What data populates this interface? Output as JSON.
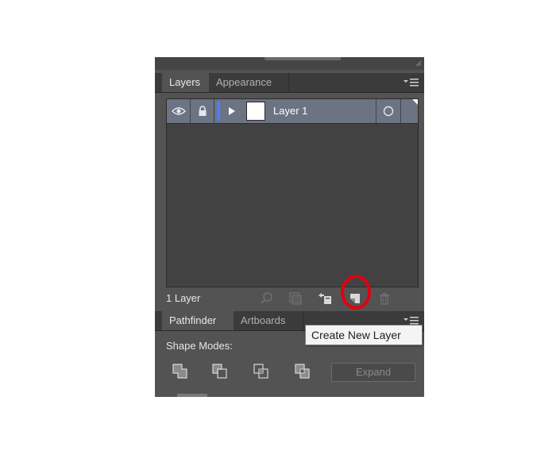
{
  "layers_panel": {
    "tabs": [
      {
        "label": "Layers",
        "active": true
      },
      {
        "label": "Appearance",
        "active": false
      }
    ],
    "layer": {
      "name": "Layer 1",
      "color": "#4f7cff"
    },
    "count_label": "1 Layer"
  },
  "footer_icons": [
    "locate-object-icon",
    "make-clipping-mask-icon",
    "create-sublayer-icon",
    "create-new-layer-icon",
    "delete-layer-icon"
  ],
  "tooltip": "Create New Layer",
  "highlight_color": "#e3000f",
  "pathfinder_panel": {
    "tabs": [
      {
        "label": "Pathfinder",
        "active": true
      },
      {
        "label": "Artboards",
        "active": false
      }
    ],
    "shape_modes_label": "Shape Modes:",
    "shape_modes": [
      "unite-icon",
      "minus-front-icon",
      "intersect-icon",
      "exclude-icon"
    ],
    "expand_label": "Expand"
  }
}
